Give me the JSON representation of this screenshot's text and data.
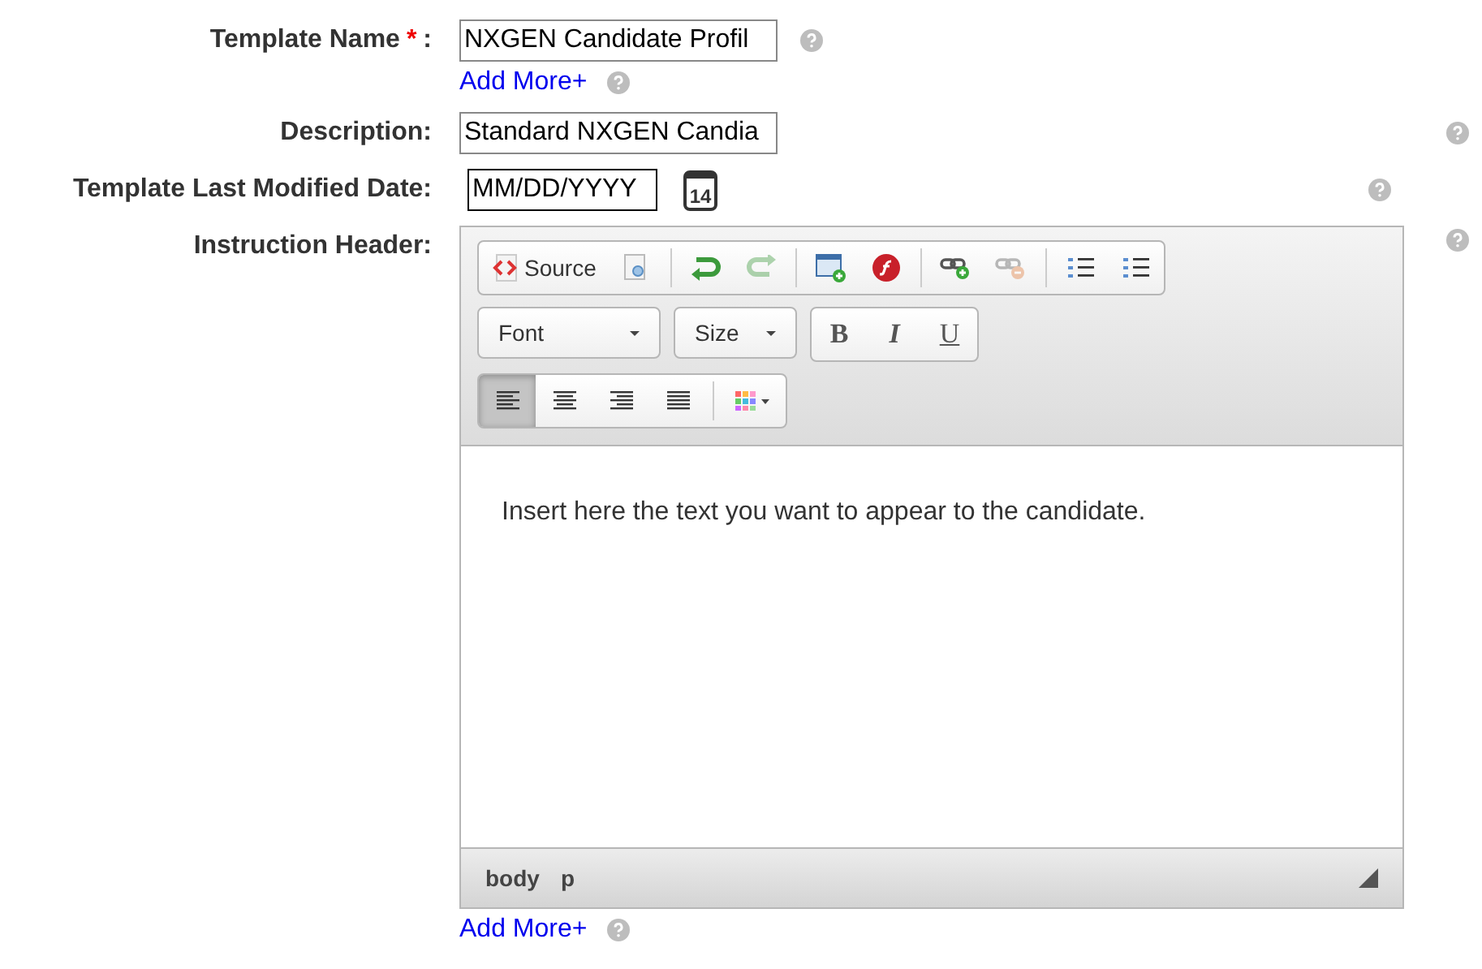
{
  "fields": [
    {
      "kind": "text",
      "label": "Template Name",
      "required": true,
      "value": "NXGEN Candidate Profil",
      "add_more": "Add More+"
    },
    {
      "kind": "text",
      "label": "Description:",
      "required": false,
      "value": "Standard NXGEN Candia"
    },
    {
      "kind": "date",
      "label": "Template Last Modified Date:",
      "required": false,
      "value": "MM/DD/YYYY",
      "calendar_day": "14"
    },
    {
      "kind": "editor",
      "label": "Instruction Header:",
      "required": false,
      "add_more": "Add More+"
    }
  ],
  "required_mark": "*",
  "label_colon": ":",
  "editor": {
    "toolbar_rows": [
      [
        {
          "kind": "source",
          "label": "Source",
          "disabled": false
        },
        {
          "kind": "preview",
          "disabled": false
        },
        {
          "kind": "sep"
        },
        {
          "kind": "undo",
          "disabled": false
        },
        {
          "kind": "redo",
          "disabled": true
        },
        {
          "kind": "sep"
        },
        {
          "kind": "image",
          "disabled": false
        },
        {
          "kind": "flash",
          "disabled": false
        },
        {
          "kind": "sep"
        },
        {
          "kind": "link",
          "disabled": false
        },
        {
          "kind": "unlink",
          "disabled": true
        },
        {
          "kind": "sep"
        },
        {
          "kind": "ol",
          "disabled": false
        },
        {
          "kind": "ul",
          "disabled": false
        }
      ],
      [
        {
          "kind": "combo",
          "label": "Font"
        },
        {
          "kind": "combo",
          "label": "Size"
        },
        {
          "kind": "group"
        },
        {
          "kind": "bold",
          "label": "B"
        },
        {
          "kind": "italic",
          "label": "I"
        },
        {
          "kind": "underline",
          "label": "U"
        }
      ],
      [
        {
          "kind": "align-left",
          "selected": true
        },
        {
          "kind": "align-center",
          "selected": false
        },
        {
          "kind": "align-right",
          "selected": false
        },
        {
          "kind": "justify",
          "selected": false
        },
        {
          "kind": "sep"
        },
        {
          "kind": "color"
        }
      ]
    ],
    "content": "Insert here the text you want to appear to the candidate.",
    "path": [
      "body",
      "p"
    ]
  }
}
